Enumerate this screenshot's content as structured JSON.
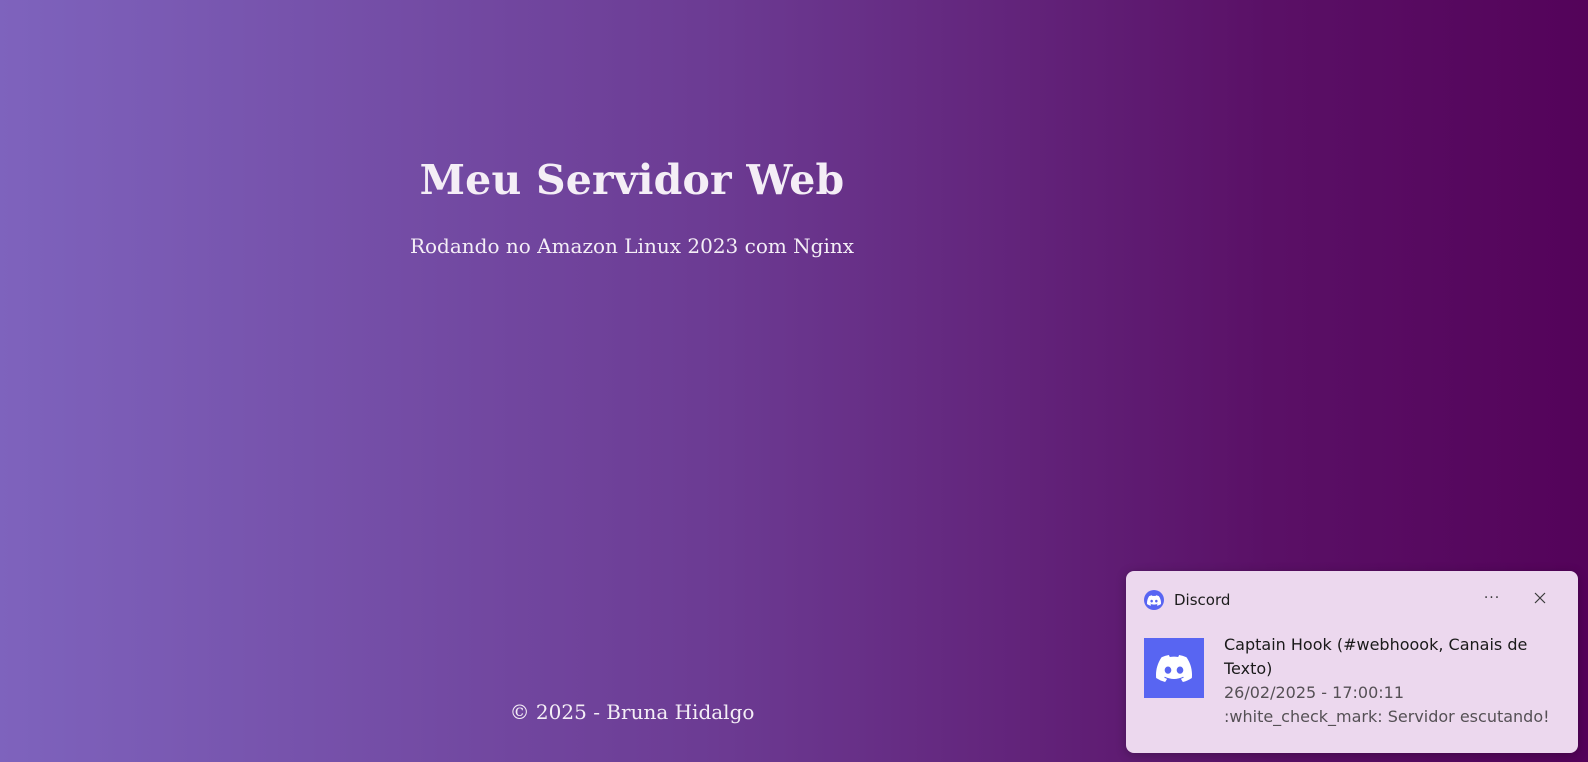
{
  "page": {
    "title": "Meu Servidor Web",
    "subtitle": "Rodando no Amazon Linux 2023 com Nginx",
    "footer": "© 2025 - Bruna Hidalgo"
  },
  "toast": {
    "app_name": "Discord",
    "more_label": "···",
    "title": "Captain Hook (#webhoook, Canais de Texto)",
    "message": "26/02/2025 - 17:00:11 :white_check_mark: Servidor escutando!",
    "app_icon": "discord-icon",
    "close_icon": "close-icon",
    "brand_color": "#5865f2"
  },
  "colors": {
    "gradient_start": "#7e63bd",
    "gradient_end": "#54035a",
    "toast_background": "#ecd8ee",
    "text_light": "#f4eef6"
  }
}
